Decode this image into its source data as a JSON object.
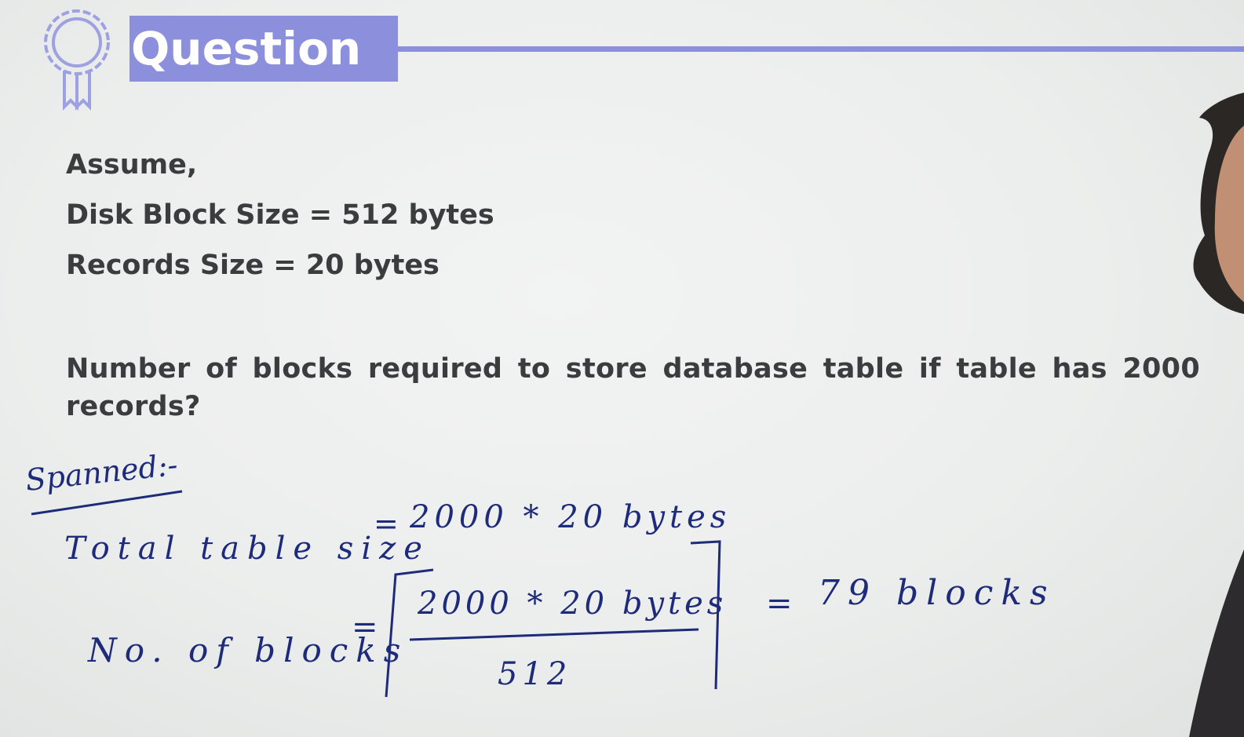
{
  "header": {
    "title": "Question",
    "badge_icon": "award-ribbon-icon",
    "accent_color": "#8b8fdc"
  },
  "given": {
    "line1": "Assume,",
    "line2": "Disk Block Size = 512 bytes",
    "line3": "Records Size = 20 bytes"
  },
  "question": "Number of blocks required to store database table if table has 2000 records?",
  "handwritten": {
    "heading": "Spanned:-",
    "total_label": "Total table size",
    "total_eq": "=",
    "total_value": "2000 * 20 bytes",
    "blocks_label": "No. of blocks",
    "blocks_eq": "=",
    "numerator": "2000 * 20 bytes",
    "denominator": "512",
    "result_eq": "=",
    "result": "79 blocks",
    "ink_color": "#1e2a7a"
  }
}
